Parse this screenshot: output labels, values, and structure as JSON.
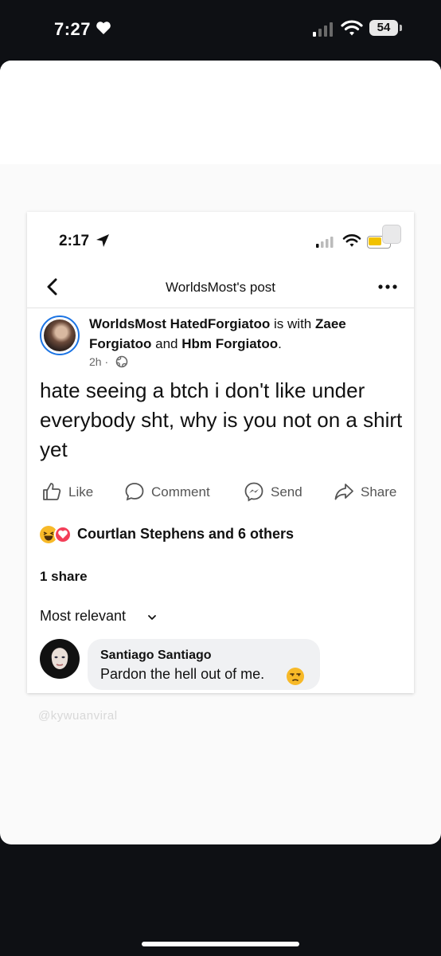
{
  "outer_status": {
    "time": "7:27",
    "battery": "54"
  },
  "inner_status": {
    "time": "2:17"
  },
  "nav": {
    "title": "WorldsMost's post"
  },
  "post": {
    "author": "WorldsMost HatedForgiatoo",
    "with_text": "is with",
    "tagged_1": "Zaee Forgiatoo",
    "and_text": "and",
    "tagged_2": "Hbm Forgiatoo",
    "end": ".",
    "time": "2h ·",
    "text": "hate seeing a btch i don't like under everybody sht, why is you not on a shirt yet"
  },
  "actions": {
    "like": "Like",
    "comment": "Comment",
    "send": "Send",
    "share": "Share"
  },
  "reactions": {
    "label": "Courtlan Stephens and 6 others"
  },
  "shares": "1 share",
  "sort": "Most relevant",
  "comment": {
    "name": "Santiago Santiago",
    "text": "Pardon the hell out of me."
  },
  "watermark": "@kywuanviral",
  "colors": {
    "accent": "#1b74e4",
    "battery_fill": "#f2c200"
  }
}
